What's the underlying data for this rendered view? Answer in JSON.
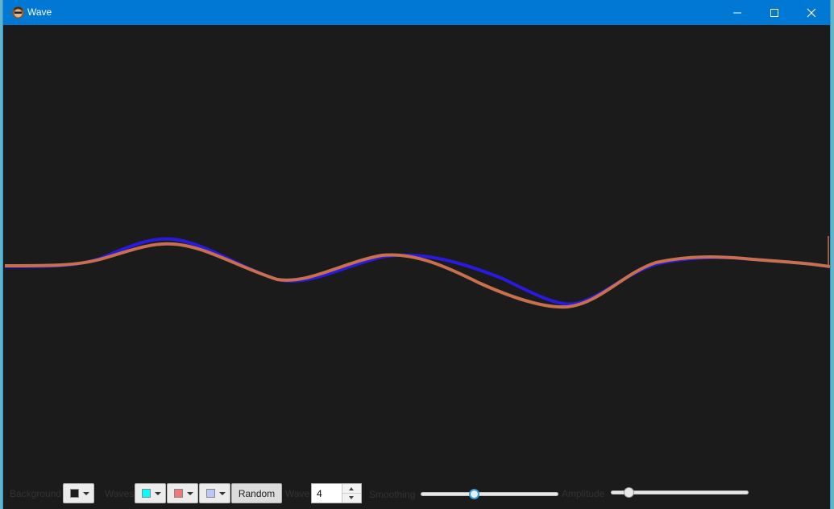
{
  "window": {
    "title": "Wave",
    "icon": "avatar-icon",
    "controls": [
      "minimize-icon",
      "maximize-icon",
      "close-icon"
    ],
    "titlebar_color": "#0078d4"
  },
  "canvas": {
    "background_color": "#1b1b1b",
    "wave_colors": [
      "#2a1ae0",
      "#c8704e"
    ]
  },
  "toolbar": {
    "background_label": "Background",
    "background_color": "#1b1b1b",
    "waves_label": "Waves",
    "wave_color_1": "#00ffff",
    "wave_color_2": "#f07878",
    "wave_color_3": "#b8c8f8",
    "random_label": "Random",
    "wave_label": "Wave",
    "wave_count": "4",
    "smoothing_label": "Smoothing",
    "smoothing_value": 0.38,
    "amplitude_label": "Amplitude",
    "amplitude_value": 0.1
  }
}
